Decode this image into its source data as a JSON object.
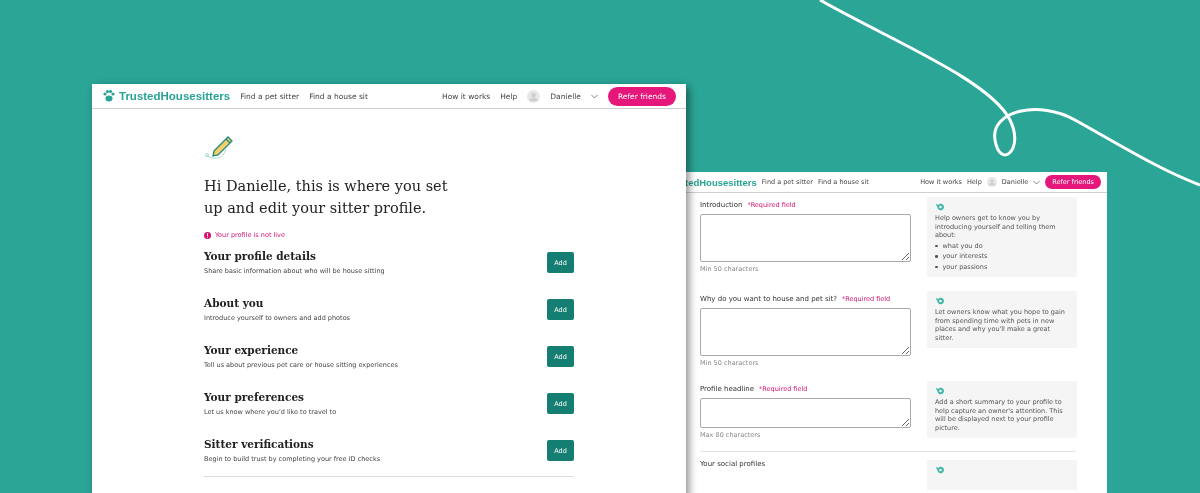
{
  "main_window": {
    "nav": {
      "logo": "TrustedHousesitters",
      "links": [
        "Find a pet sitter",
        "Find a house sit"
      ],
      "right_links": [
        "How it works",
        "Help"
      ],
      "user": "Danielle",
      "cta": "Refer friends"
    },
    "heading": "Hi Danielle, this is where you set up and edit your sitter profile.",
    "status": "Your profile is not live",
    "sections": [
      {
        "title": "Your profile details",
        "description": "Share basic information about who will be house sitting",
        "button": "Add"
      },
      {
        "title": "About you",
        "description": "Introduce yourself to owners and add photos",
        "button": "Add"
      },
      {
        "title": "Your experience",
        "description": "Tell us about previous pet care or house sitting experiences",
        "button": "Add"
      },
      {
        "title": "Your preferences",
        "description": "Let us know where you'd like to travel to",
        "button": "Add"
      },
      {
        "title": "Sitter verifications",
        "description": "Begin to build trust by completing your free ID checks",
        "button": "Add"
      }
    ]
  },
  "second_window": {
    "nav": {
      "logo": "tedHousesitters",
      "links": [
        "Find a pet sitter",
        "Find a house sit"
      ],
      "right_links": [
        "How it works",
        "Help"
      ],
      "user": "Danielle",
      "cta": "Refer friends"
    },
    "fields": [
      {
        "label": "Introduction",
        "required": "*Required field",
        "hint": "Min 50 characters",
        "kind": "long",
        "help": {
          "text": "Help owners get to know you by introducing yourself and telling them about:",
          "bullets": [
            "what you do",
            "your interests",
            "your passions"
          ]
        }
      },
      {
        "label": "Why do you want to house and pet sit?",
        "required": "*Required field",
        "hint": "Min 50 characters",
        "kind": "long",
        "help": {
          "text": "Let owners know what you hope to gain from spending time with pets in new places and why you'll make a great sitter."
        }
      },
      {
        "label": "Profile headline",
        "required": "*Required field",
        "hint": "Max 80 characters",
        "kind": "short",
        "help": {
          "text": "Add a short summary to your profile to help capture an owner's attention. This will be displayed next to your profile picture."
        }
      }
    ],
    "social": {
      "title": "Your social profiles"
    }
  }
}
